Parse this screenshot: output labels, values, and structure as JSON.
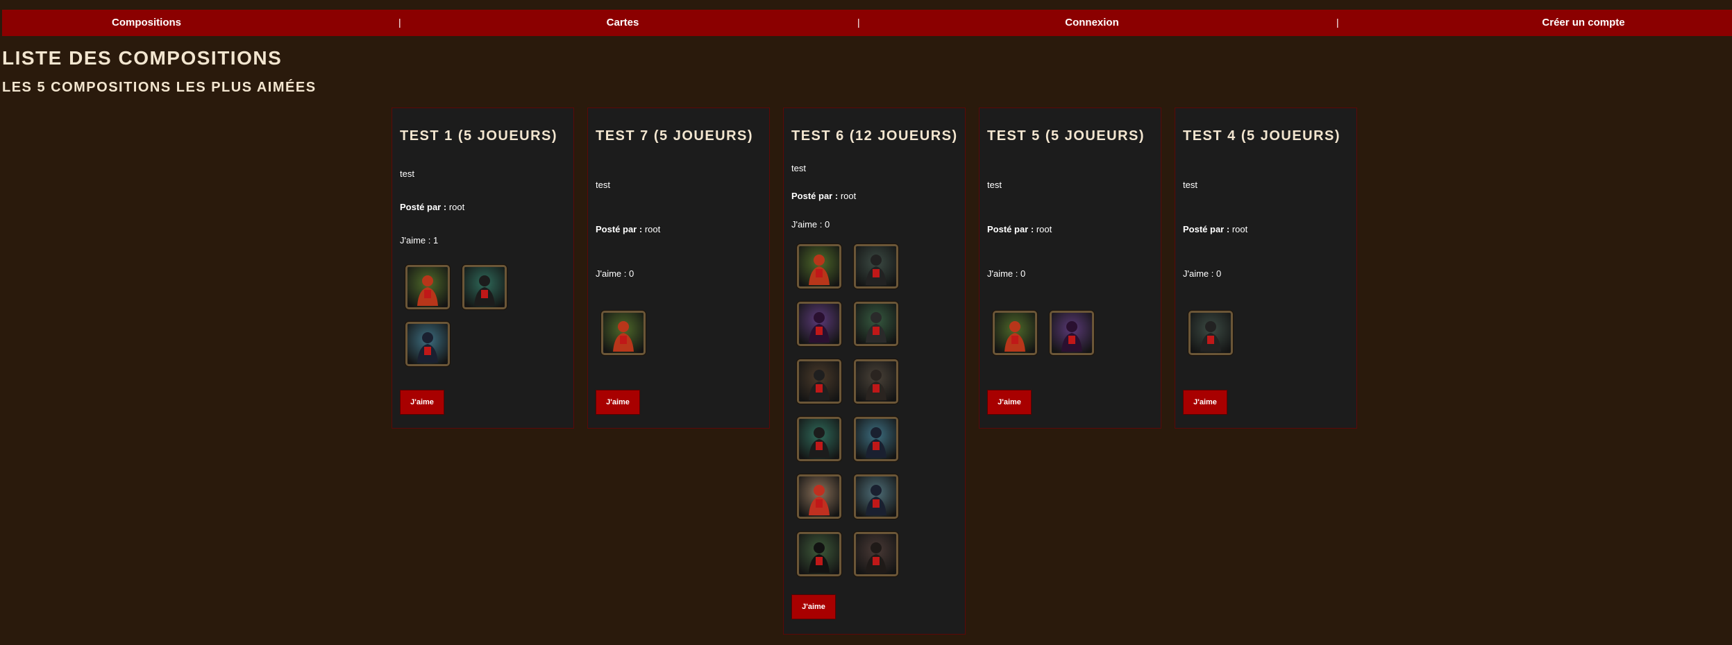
{
  "nav": {
    "items": [
      "Compositions",
      "Cartes",
      "Connexion",
      "Créer un compte"
    ],
    "separator": "|"
  },
  "page_title": "LISTE DES COMPOSITIONS",
  "section_title": "LES 5 COMPOSITIONS LES PLUS AIMÉES",
  "labels": {
    "posted_by": "Posté par :",
    "likes": "J'aime :",
    "like_button": "J'aime"
  },
  "cards": [
    {
      "title": "TEST 1 (5 JOUEURS)",
      "description": "test",
      "author": "root",
      "likes": "1",
      "cards": [
        {
          "name": "fox-card-icon",
          "bg": "#4f6a2a",
          "fg": "#b8361a"
        },
        {
          "name": "witch-card-icon",
          "bg": "#2f6a5a",
          "fg": "#1c1c1c"
        },
        {
          "name": "werewolf-card-icon",
          "bg": "#3d6e80",
          "fg": "#1a2030"
        }
      ]
    },
    {
      "title": "TEST 7 (5 JOUEURS)",
      "description": "test",
      "author": "root",
      "likes": "0",
      "cards": [
        {
          "name": "fox-card-icon",
          "bg": "#4f6a2a",
          "fg": "#b8361a"
        }
      ]
    },
    {
      "title": "TEST 6 (12 JOUEURS)",
      "description": "test",
      "author": "root",
      "likes": "0",
      "cards": [
        {
          "name": "fox-card-icon",
          "bg": "#4f6a2a",
          "fg": "#b8361a"
        },
        {
          "name": "villagers-card-icon",
          "bg": "#3c4b44",
          "fg": "#222222"
        },
        {
          "name": "seer-card-icon",
          "bg": "#5b3a78",
          "fg": "#2a1030"
        },
        {
          "name": "witch-cauldron-card-icon",
          "bg": "#365a40",
          "fg": "#2a2a2a"
        },
        {
          "name": "hunter-card-icon",
          "bg": "#4a3a2a",
          "fg": "#1f1f1f"
        },
        {
          "name": "elder-card-icon",
          "bg": "#4a4238",
          "fg": "#2a2420"
        },
        {
          "name": "witch-card-icon",
          "bg": "#2f6a5a",
          "fg": "#1c1c1c"
        },
        {
          "name": "little-girl-card-icon",
          "bg": "#3d6e80",
          "fg": "#1a2030"
        },
        {
          "name": "cupid-card-icon",
          "bg": "#8a7058",
          "fg": "#c03020"
        },
        {
          "name": "werewolf-card-icon",
          "bg": "#4e6e78",
          "fg": "#1a2030"
        },
        {
          "name": "wolf-dog-card-icon",
          "bg": "#3e5a3a",
          "fg": "#121212"
        },
        {
          "name": "red-riding-hood-card-icon",
          "bg": "#4a3a36",
          "fg": "#1f1a18"
        }
      ]
    },
    {
      "title": "TEST 5 (5 JOUEURS)",
      "description": "test",
      "author": "root",
      "likes": "0",
      "cards": [
        {
          "name": "fox-card-icon",
          "bg": "#4f6a2a",
          "fg": "#b8361a"
        },
        {
          "name": "seer-card-icon",
          "bg": "#5b3a78",
          "fg": "#2a1030"
        }
      ]
    },
    {
      "title": "TEST 4 (5 JOUEURS)",
      "description": "test",
      "author": "root",
      "likes": "0",
      "cards": [
        {
          "name": "villagers-card-icon",
          "bg": "#3c4b44",
          "fg": "#222222"
        }
      ]
    }
  ]
}
